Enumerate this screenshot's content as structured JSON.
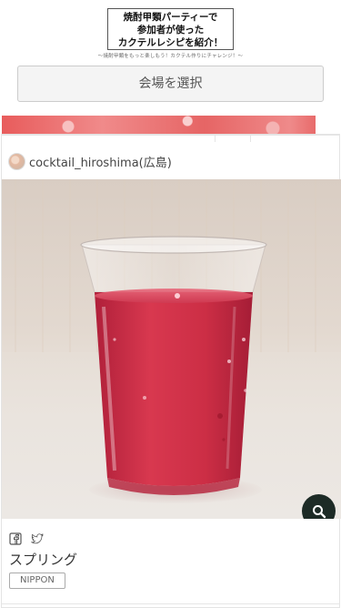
{
  "header": {
    "logo_line1": "焼酎甲類パーティーで",
    "logo_line2": "参加者が使った",
    "logo_line3": "カクテルレシピを紹介！",
    "tagline": "〜焼酎甲類をもっと楽しもう！カクテル作りにチャレンジ！〜",
    "venue_button_label": "会場を選択"
  },
  "post": {
    "username": "cocktail_hiroshima(広島)",
    "title": "スプリング",
    "tag": "NIPPON",
    "icons": {
      "facebook": "facebook-icon",
      "twitter": "twitter-icon",
      "zoom": "magnifier-icon"
    }
  },
  "colors": {
    "drink": "#c8283f",
    "zoom_button": "#1d2b26",
    "banner": "#e85b5b"
  }
}
